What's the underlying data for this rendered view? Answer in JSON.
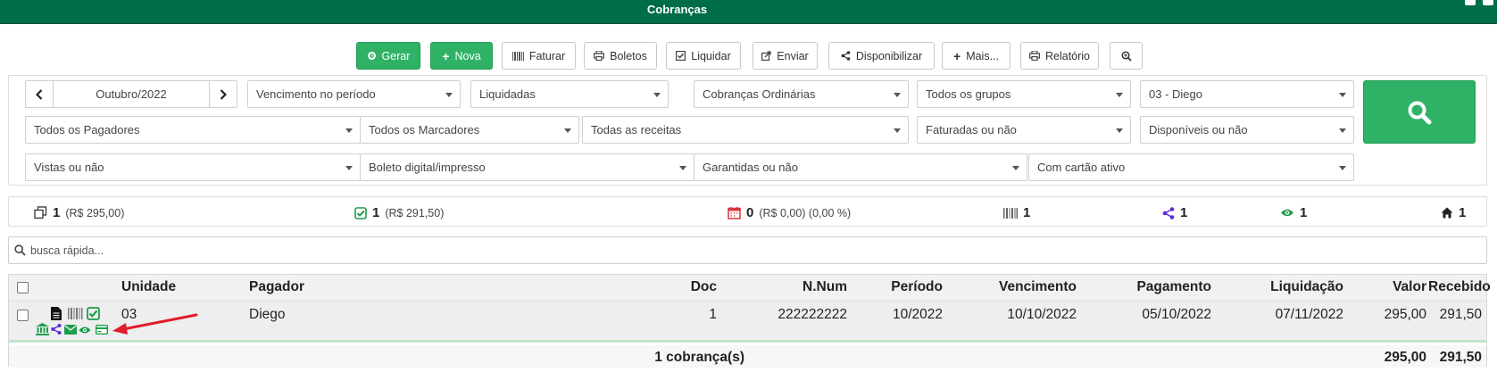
{
  "window": {
    "title": "Cobranças"
  },
  "toolbar": {
    "gerar": "Gerar",
    "nova": "Nova",
    "faturar": "Faturar",
    "boletos": "Boletos",
    "liquidar": "Liquidar",
    "enviar": "Enviar",
    "disponibilizar": "Disponibilizar",
    "mais": "Mais...",
    "relatorio": "Relatório"
  },
  "filters": {
    "month": "Outubro/2022",
    "row1": [
      "Vencimento no período",
      "Liquidadas",
      "Cobranças Ordinárias",
      "Todos os grupos",
      "03 - Diego"
    ],
    "row2": [
      "Todos os Pagadores",
      "Todos os Marcadores",
      "Todas as receitas",
      "Faturadas ou não",
      "Disponíveis ou não"
    ],
    "row3": [
      "Vistas ou não",
      "Boleto digital/impresso",
      "Garantidas ou não",
      "Com cartão ativo"
    ]
  },
  "stats": {
    "total_count": "1",
    "total_value": "(R$ 295,00)",
    "paid_count": "1",
    "paid_value": "(R$ 291,50)",
    "overdue_count": "0",
    "overdue_value": "(R$ 0,00) (0,00 %)",
    "barcode_count": "1",
    "shared_count": "1",
    "viewed_count": "1",
    "home_count": "1"
  },
  "search": {
    "placeholder": "busca rápida..."
  },
  "table": {
    "headers": {
      "unidade": "Unidade",
      "pagador": "Pagador",
      "doc": "Doc",
      "nnum": "N.Num",
      "periodo": "Período",
      "vencimento": "Vencimento",
      "pagamento": "Pagamento",
      "liquidacao": "Liquidação",
      "valor": "Valor",
      "recebido": "Recebido"
    },
    "rows": [
      {
        "unidade": "03",
        "pagador": "Diego",
        "doc": "1",
        "nnum": "222222222",
        "periodo": "10/2022",
        "vencimento": "10/10/2022",
        "pagamento": "05/10/2022",
        "liquidacao": "07/11/2022",
        "valor": "295,00",
        "recebido": "291,50"
      }
    ],
    "footer": {
      "count": "1 cobrança(s)",
      "valor": "295,00",
      "recebido": "291,50"
    }
  },
  "colors": {
    "header_bg": "#006d4a",
    "button_green": "#2fb266",
    "status_green": "#1f9d4c",
    "share_purple": "#5b2bd4",
    "calendar_red": "#d9363e",
    "arrow_red": "#e11d2b"
  }
}
